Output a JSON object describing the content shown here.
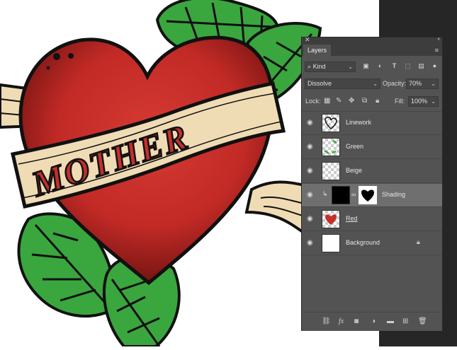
{
  "artwork": {
    "banner_text": "MOTHER",
    "colors": {
      "heart_red": "#c62e2a",
      "leaf_green": "#3aa63e",
      "banner_beige": "#f0dcb4",
      "linework": "#111111"
    }
  },
  "panel": {
    "tab_label": "Layers",
    "filter_kind": "Kind",
    "filter_icons": [
      "image-filter-icon",
      "adjustment-filter-icon",
      "type-filter-icon",
      "shape-filter-icon",
      "smart-object-filter-icon"
    ],
    "blend_mode": "Dissolve",
    "opacity_label": "Opacity:",
    "opacity_value": "70%",
    "lock_label": "Lock:",
    "lock_icons": [
      "lock-transparent-icon",
      "lock-image-icon",
      "lock-position-icon",
      "lock-artboard-icon",
      "lock-all-icon"
    ],
    "fill_label": "Fill:",
    "fill_value": "100%",
    "layers": [
      {
        "name": "Linework",
        "visible": true
      },
      {
        "name": "Green",
        "visible": true
      },
      {
        "name": "Beige",
        "visible": true
      },
      {
        "name": "Shading",
        "visible": true,
        "selected": true,
        "clipped": true,
        "has_mask": true
      },
      {
        "name": "Red",
        "visible": true
      },
      {
        "name": "Background",
        "visible": true,
        "locked": true
      }
    ],
    "bottom_icons": [
      "link-layers-icon",
      "fx-icon",
      "add-mask-icon",
      "adjustment-layer-icon",
      "group-folder-icon",
      "new-layer-icon",
      "trash-icon"
    ]
  }
}
